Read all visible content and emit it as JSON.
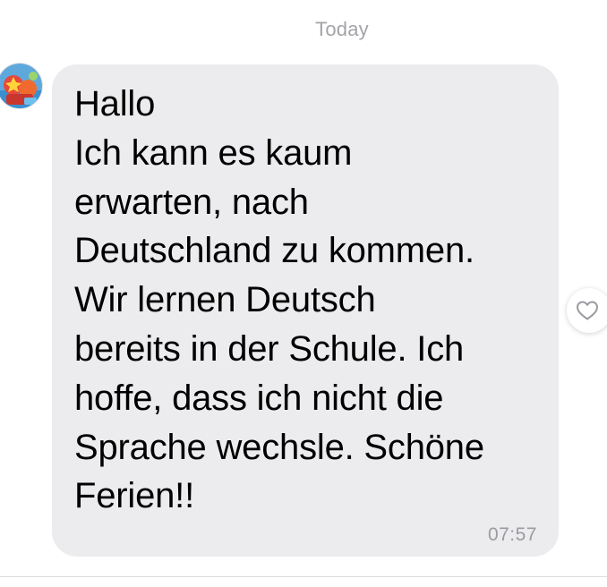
{
  "conversation": {
    "date_divider": "Today"
  },
  "message": {
    "sender_avatar": "avatar-icon",
    "text": "Hallo\nIch kann es kaum\nerwarten, nach\nDeutschland zu kommen.\nWir lernen Deutsch\nbereits in der Schule. Ich\nhoffe, dass ich nicht die\nSprache wechsle. Schöne\nFerien!!",
    "time": "07:57",
    "reaction_icon": "heart-outline-icon"
  },
  "colors": {
    "bubble": "#ececee",
    "meta_text": "#a3a3a8",
    "message_text": "#000000"
  }
}
